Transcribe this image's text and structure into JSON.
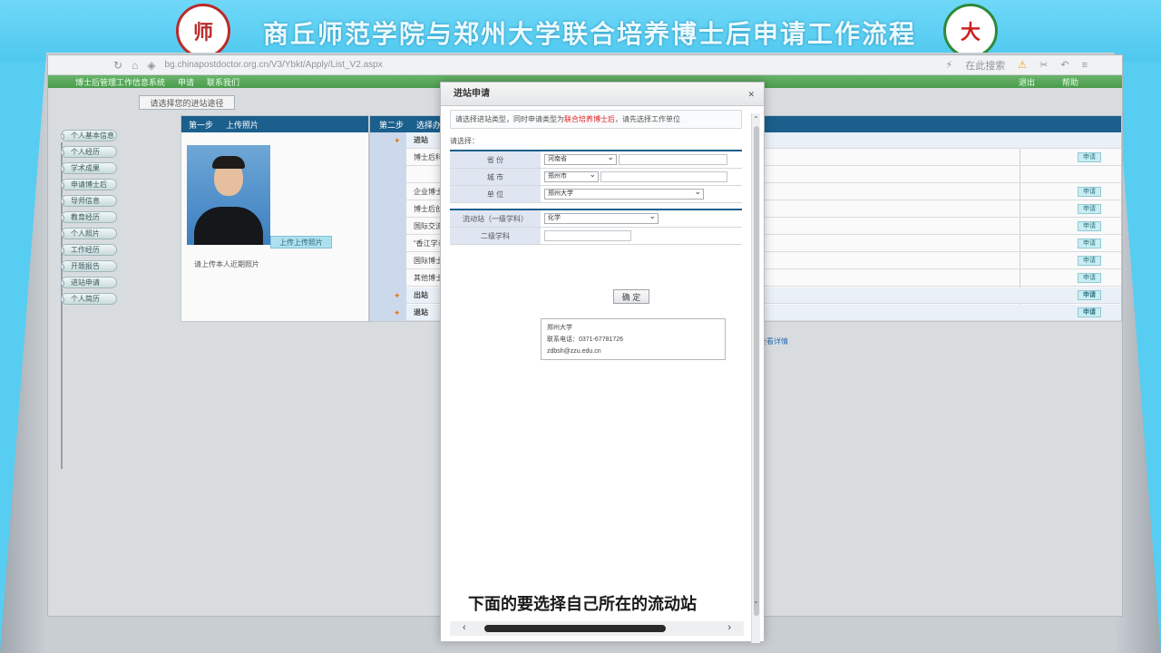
{
  "banner": {
    "title": "商丘师范学院与郑州大学联合培养博士后申请工作流程",
    "logo_left": "师",
    "logo_right": "大"
  },
  "browser": {
    "url": "bg.chinapostdoctor.org.cn/V3/Ybkt/Apply/List_V2.aspx",
    "search_label": "在此搜索"
  },
  "site_bar": {
    "left_items": [
      "博士后管理工作信息系统",
      "申请",
      "联系我们"
    ],
    "right_items": [
      "退出",
      "帮助"
    ]
  },
  "sidebar": {
    "items": [
      "个人基本信息",
      "个人经历",
      "学术成果",
      "申请博士后",
      "导师信息",
      "教育经历",
      "个人照片",
      "工作经历",
      "开题报告",
      "进站申请",
      "个人简历"
    ]
  },
  "tab": {
    "label": "请选择您的进站途径"
  },
  "step1": {
    "label": "第一步",
    "title": "上传照片",
    "upload_button": "上传上传照片",
    "status": "请上传本人近期照片"
  },
  "step2": {
    "label": "第二步",
    "title": "选择办理事项",
    "rows": [
      {
        "text": "进站",
        "section": true,
        "button": ""
      },
      {
        "text": "博士后科研流动站",
        "section": false,
        "button": "申请"
      },
      {
        "text": "",
        "section": false,
        "button": ""
      },
      {
        "text": "企业博士后工作站",
        "section": false,
        "button": "申请"
      },
      {
        "text": "博士后创新实践基地",
        "section": false,
        "button": "申请"
      },
      {
        "text": "国际交流计划",
        "section": false,
        "button": "申请"
      },
      {
        "text": "“香江学者”计划",
        "section": false,
        "button": "申请"
      },
      {
        "text": "国际博士后引进项目",
        "section": false,
        "button": "申请"
      },
      {
        "text": "其他博士后项目",
        "section": false,
        "button": "申请"
      },
      {
        "text": "出站",
        "section": true,
        "button": "申请"
      },
      {
        "text": "退站",
        "section": true,
        "button": "申请"
      }
    ],
    "link": "查看详情"
  },
  "dialog": {
    "title": "进站申请",
    "close": "✕",
    "notice_prefix": "请选择进站类型，同时申请类型为",
    "notice_red": "联合培养博士后",
    "notice_suffix": "，请先选择工作单位",
    "fill_label": "请选择：",
    "fields": [
      {
        "label": "省   份",
        "value": "河南省"
      },
      {
        "label": "城   市",
        "value": "郑州市"
      },
      {
        "label": "单   位",
        "value": "郑州大学"
      }
    ],
    "fields2": [
      {
        "label": "流动站（一级学科）",
        "value": "化学"
      },
      {
        "label": "二级学科",
        "value": ""
      }
    ],
    "confirm": "确 定",
    "contact": [
      "郑州大学",
      "联系电话：0371-67781726",
      "zdbsh@zzu.edu.cn"
    ]
  },
  "subtitle": "下面的要选择自己所在的流动站"
}
